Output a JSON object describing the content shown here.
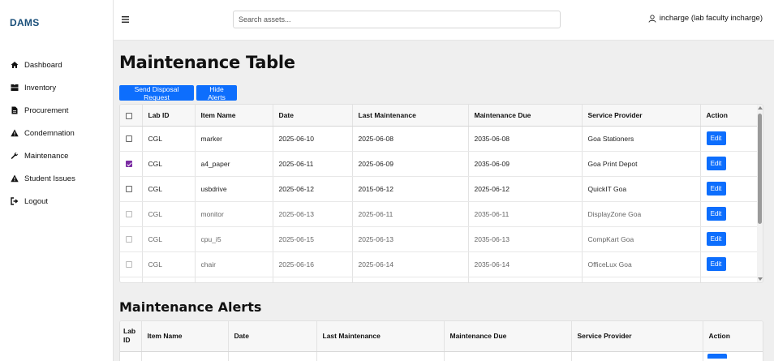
{
  "brand": "DAMS",
  "sidebar": {
    "items": [
      {
        "label": "Dashboard",
        "icon": "home-icon"
      },
      {
        "label": "Inventory",
        "icon": "box-icon"
      },
      {
        "label": "Procurement",
        "icon": "file-icon"
      },
      {
        "label": "Condemnation",
        "icon": "warning-icon"
      },
      {
        "label": "Maintenance",
        "icon": "wrench-icon"
      },
      {
        "label": "Student Issues",
        "icon": "warning-icon"
      },
      {
        "label": "Logout",
        "icon": "logout-icon"
      }
    ]
  },
  "header": {
    "search_placeholder": "Search assets...",
    "user": "incharge (lab faculty incharge)"
  },
  "main": {
    "title": "Maintenance Table",
    "send_disposal_label": "Send Disposal Request",
    "hide_alerts_label": "Hide Alerts",
    "table": {
      "columns": [
        "Lab ID",
        "Item Name",
        "Date",
        "Last Maintenance",
        "Maintenance Due",
        "Service Provider",
        "Action"
      ],
      "rows": [
        {
          "checked": false,
          "lab": "CGL",
          "item": "marker",
          "date": "2025-06-10",
          "last": "2025-06-08",
          "due": "2035-06-08",
          "provider": "Goa Stationers",
          "action": "Edit"
        },
        {
          "checked": true,
          "lab": "CGL",
          "item": "a4_paper",
          "date": "2025-06-11",
          "last": "2025-06-09",
          "due": "2035-06-09",
          "provider": "Goa Print Depot",
          "action": "Edit"
        },
        {
          "checked": false,
          "lab": "CGL",
          "item": "usbdrive",
          "date": "2025-06-12",
          "last": "2015-06-12",
          "due": "2025-06-12",
          "provider": "QuickIT Goa",
          "action": "Edit"
        },
        {
          "checked": false,
          "lab": "CGL",
          "item": "monitor",
          "date": "2025-06-13",
          "last": "2025-06-11",
          "due": "2035-06-11",
          "provider": "DisplayZone Goa",
          "action": "Edit"
        },
        {
          "checked": false,
          "lab": "CGL",
          "item": "cpu_i5",
          "date": "2025-06-15",
          "last": "2025-06-13",
          "due": "2035-06-13",
          "provider": "CompKart Goa",
          "action": "Edit"
        },
        {
          "checked": false,
          "lab": "CGL",
          "item": "chair",
          "date": "2025-06-16",
          "last": "2025-06-14",
          "due": "2035-06-14",
          "provider": "OfficeLux Goa",
          "action": "Edit"
        }
      ]
    },
    "alerts": {
      "title": "Maintenance Alerts",
      "columns": [
        "Lab ID",
        "Item Name",
        "Date",
        "Last Maintenance",
        "Maintenance Due",
        "Service Provider",
        "Action"
      ]
    }
  },
  "colors": {
    "accent": "#0d6efd",
    "brand": "#1a4f7a",
    "checkbox_checked": "#7b2ca3"
  }
}
